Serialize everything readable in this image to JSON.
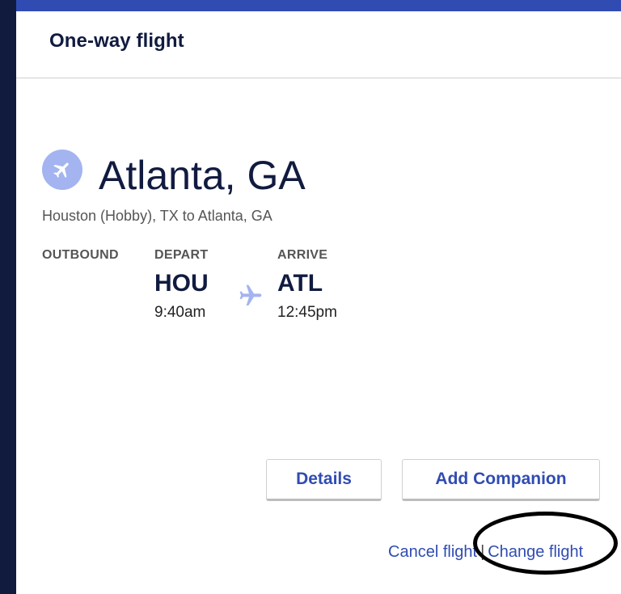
{
  "header": {
    "title": "One-way flight"
  },
  "destination": {
    "city": "Atlanta, GA",
    "icon": "airplane-icon"
  },
  "route": "Houston (Hobby), TX to Atlanta, GA",
  "flight": {
    "direction_label": "OUTBOUND",
    "depart": {
      "label": "DEPART",
      "code": "HOU",
      "time": "9:40am"
    },
    "arrive": {
      "label": "ARRIVE",
      "code": "ATL",
      "time": "12:45pm"
    }
  },
  "actions": {
    "details_label": "Details",
    "add_companion_label": "Add Companion",
    "cancel_flight_label": "Cancel flight",
    "separator": "|",
    "change_flight_label": "Change flight"
  },
  "colors": {
    "accent": "#304cb2",
    "dark_text": "#111b40",
    "icon_bg": "#a3b4f0",
    "page_bg": "#111b3d"
  }
}
